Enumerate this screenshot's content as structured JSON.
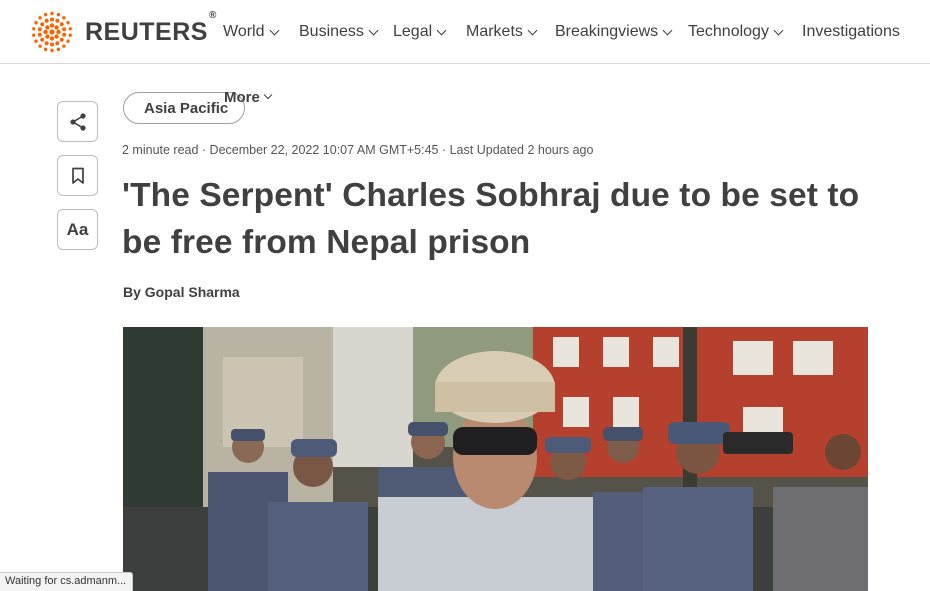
{
  "brand": {
    "name": "REUTERS",
    "reg": "®",
    "accent": "#fa6400"
  },
  "nav": [
    {
      "label": "World",
      "dropdown": true
    },
    {
      "label": "Business",
      "dropdown": true
    },
    {
      "label": "Legal",
      "dropdown": true
    },
    {
      "label": "Markets",
      "dropdown": true
    },
    {
      "label": "Breakingviews",
      "dropdown": true
    },
    {
      "label": "Technology",
      "dropdown": true
    },
    {
      "label": "Investigations",
      "dropdown": false
    },
    {
      "label": "More",
      "dropdown": true
    }
  ],
  "tools": {
    "share_icon": "share-icon",
    "bookmark_icon": "bookmark-icon",
    "text_size_label": "Aa"
  },
  "article": {
    "section": "Asia Pacific",
    "read_time": "2 minute read",
    "published": "December 22, 2022 10:07 AM GMT+5:45",
    "updated": "Last Updated 2 hours ago",
    "headline": "'The Serpent' Charles Sobhraj due to be set to be free from Nepal prison",
    "byline_prefix": "By",
    "author": "Gopal Sharma"
  },
  "status_bar": "Waiting for cs.admanm..."
}
